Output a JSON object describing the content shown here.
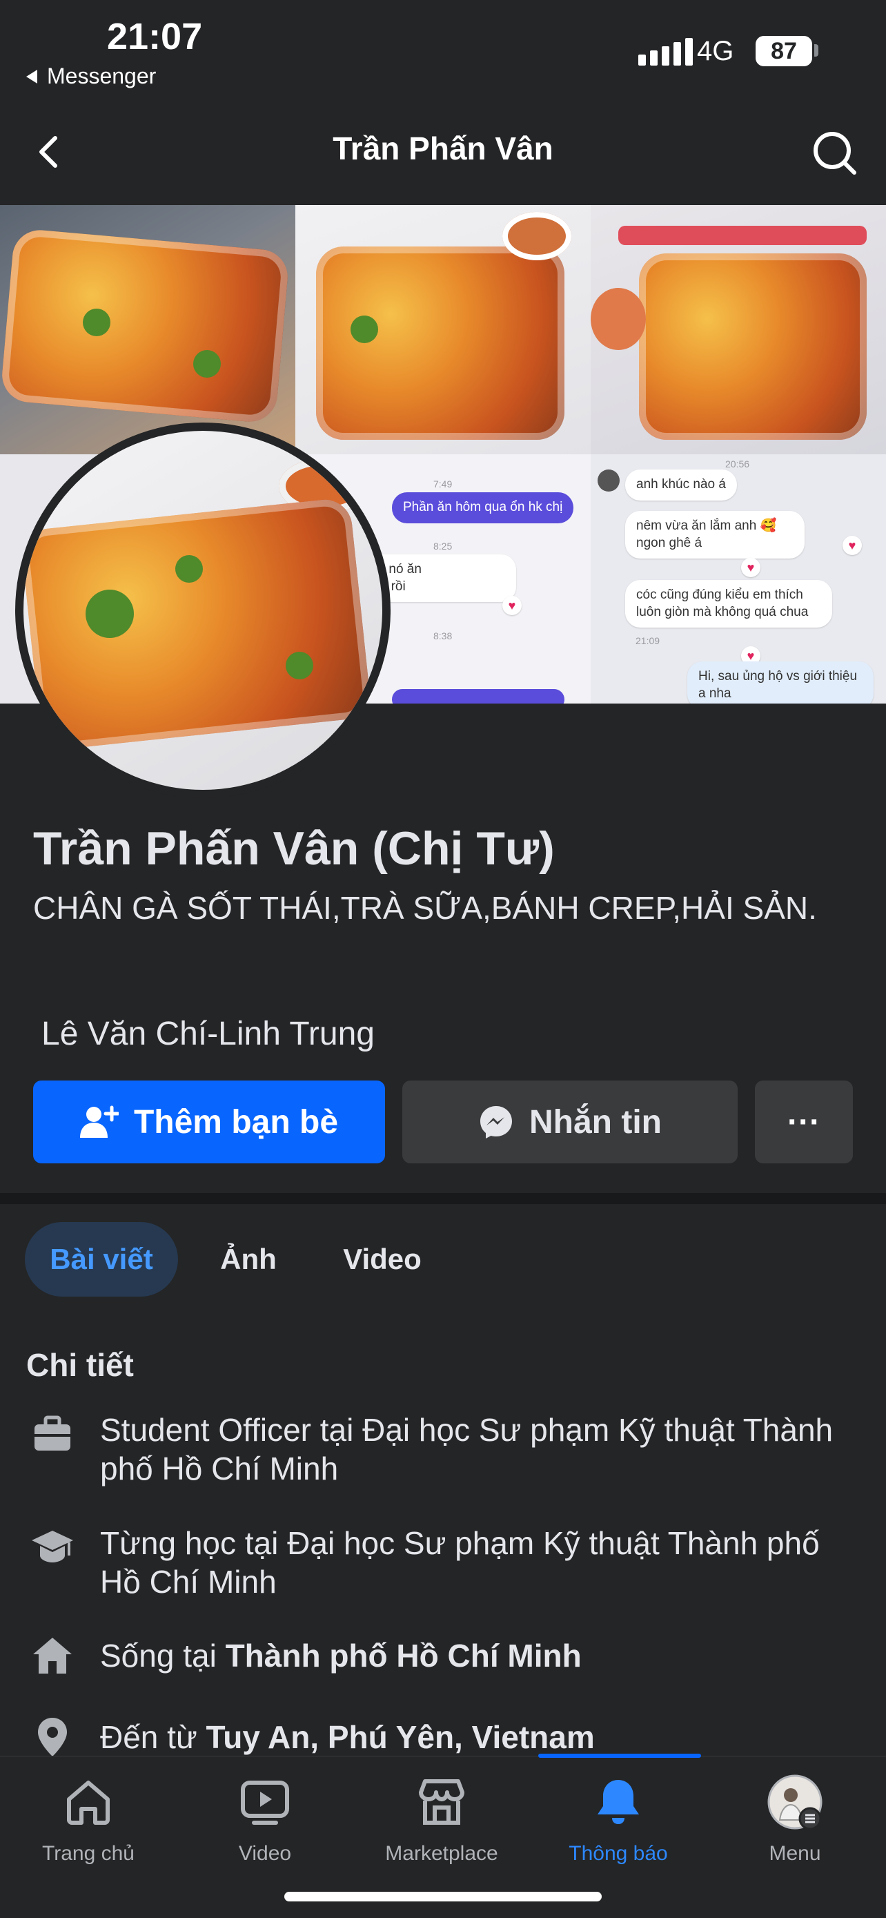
{
  "status_bar": {
    "time": "21:07",
    "back_app": "Messenger",
    "network": "4G",
    "battery": "87"
  },
  "header": {
    "title": "Trần Phấn Vân"
  },
  "cover_chat": {
    "time1": "7:49",
    "msg1": "Phần ăn hôm qua ổn hk chị",
    "time2": "8:25",
    "msg2": "ám em cháu chị nó ăn\nn lúc lấy lên nhà rồi",
    "time3": "8:38",
    "time4": "20:56",
    "msg4": "anh khúc nào á",
    "msg5": "nêm vừa ăn lắm anh 🥰 ngon ghê á",
    "msg6": "cóc cũng đúng kiểu em thích luôn giòn mà không quá chua",
    "time6": "21:09",
    "msg7": "Hi, sau ủng hộ vs giới thiệu a nha"
  },
  "profile": {
    "name": "Trần Phấn Vân (Chị Tư)",
    "bio": "CHÂN GÀ SỐT THÁI,TRÀ SỮA,BÁNH CREP,HẢI SẢN.",
    "mutual": "Lê Văn Chí-Linh Trung"
  },
  "actions": {
    "add_friend": "Thêm bạn bè",
    "message": "Nhắn tin",
    "more": "···"
  },
  "tabs": {
    "posts": "Bài viết",
    "photos": "Ảnh",
    "videos": "Video"
  },
  "details": {
    "title": "Chi tiết",
    "work": "Student Officer tại Đại học Sư phạm Kỹ thuật Thành phố Hồ Chí Minh",
    "education": "Từng học tại Đại học Sư phạm Kỹ thuật Thành phố Hồ Chí Minh",
    "lives_prefix": "Sống tại ",
    "lives_place": "Thành phố Hồ Chí Minh",
    "from_prefix": "Đến từ ",
    "from_place": "Tuy An, Phú Yên, Vietnam"
  },
  "bottom_nav": {
    "home": "Trang chủ",
    "video": "Video",
    "marketplace": "Marketplace",
    "notifications": "Thông báo",
    "menu": "Menu"
  },
  "colors": {
    "background": "#242526",
    "primary_button": "#0866ff",
    "secondary_button": "#3a3b3c",
    "active_tab_bg": "#263951",
    "active_tab_text": "#4599ff",
    "active_nav": "#2d88ff"
  }
}
